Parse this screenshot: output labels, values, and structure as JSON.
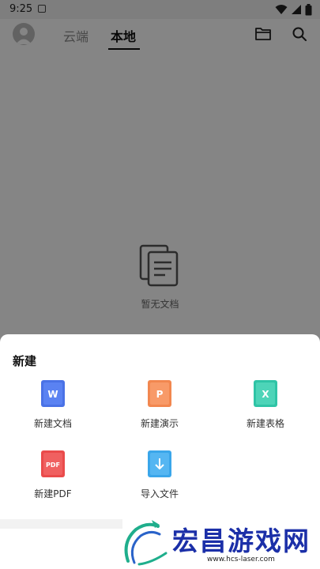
{
  "status_bar": {
    "time": "9:25"
  },
  "header": {
    "tabs": [
      {
        "label": "云端",
        "selected": false
      },
      {
        "label": "本地",
        "selected": true
      }
    ]
  },
  "empty_state": {
    "text": "暂无文档"
  },
  "new_sheet": {
    "title": "新建",
    "actions": [
      {
        "label": "新建文档",
        "badge": "W",
        "color": "#4a72e6",
        "icon": "word-doc-icon"
      },
      {
        "label": "新建演示",
        "badge": "P",
        "color": "#f2874f",
        "icon": "ppt-doc-icon"
      },
      {
        "label": "新建表格",
        "badge": "X",
        "color": "#2fc4a6",
        "icon": "excel-doc-icon"
      },
      {
        "label": "新建PDF",
        "badge": "PDF",
        "color": "#ea4b4b",
        "icon": "pdf-doc-icon"
      },
      {
        "label": "导入文件",
        "badge": "↓",
        "color": "#3aa6ea",
        "icon": "import-file-icon"
      }
    ]
  },
  "watermark": {
    "brand": "宏昌游戏网",
    "url": "www.hcs-laser.com"
  }
}
